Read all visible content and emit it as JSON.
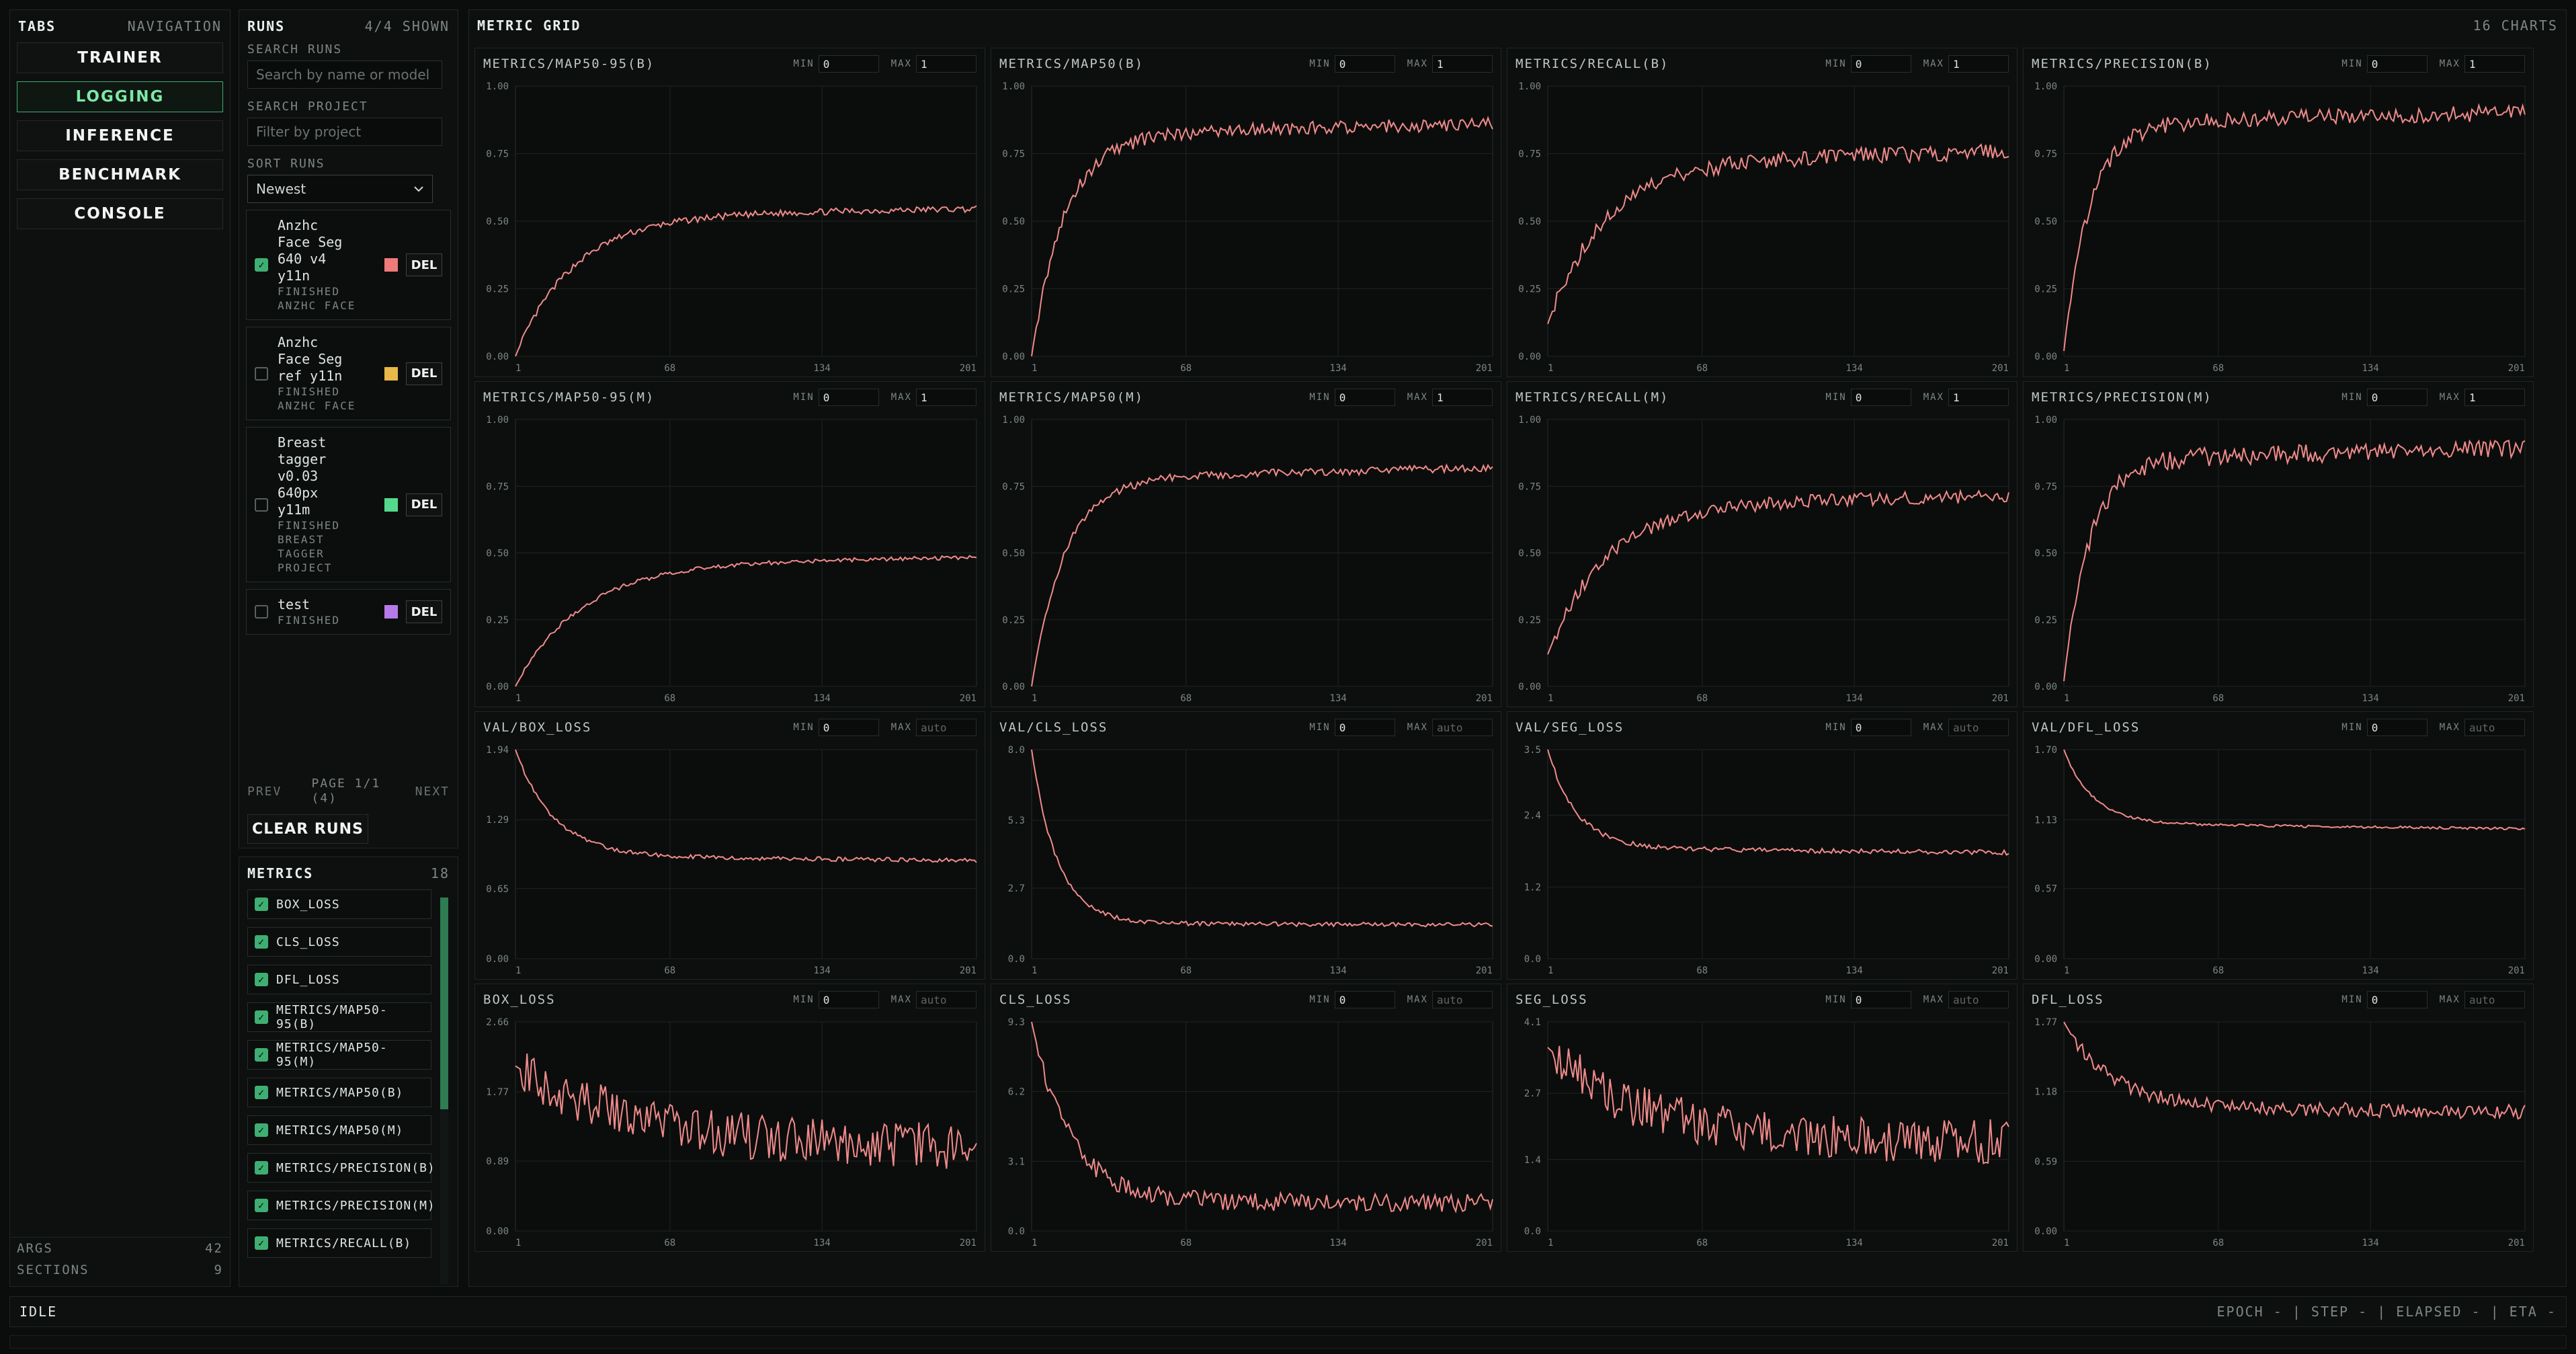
{
  "colors": {
    "series": "#f08b8b",
    "accent": "#3fae72"
  },
  "tabs": {
    "title": "TABS",
    "meta": "NAVIGATION",
    "items": [
      {
        "label": "TRAINER",
        "active": false
      },
      {
        "label": "LOGGING",
        "active": true
      },
      {
        "label": "INFERENCE",
        "active": false
      },
      {
        "label": "BENCHMARK",
        "active": false
      },
      {
        "label": "CONSOLE",
        "active": false
      }
    ],
    "footer": [
      {
        "label": "ARGS",
        "value": "42"
      },
      {
        "label": "SECTIONS",
        "value": "9"
      }
    ]
  },
  "runs": {
    "title": "RUNS",
    "meta": "4/4 SHOWN",
    "search_runs_label": "SEARCH RUNS",
    "search_runs_placeholder": "Search by name or model",
    "search_project_label": "SEARCH PROJECT",
    "search_project_placeholder": "Filter by project",
    "sort_label": "SORT RUNS",
    "sort_value": "Newest",
    "items": [
      {
        "name": "Anzhc Face Seg 640 v4 y11n",
        "status": "FINISHED",
        "project": "ANZHC FACE",
        "checked": true,
        "color": "#ee7a7a",
        "del": "DEL"
      },
      {
        "name": "Anzhc Face Seg ref y11n",
        "status": "FINISHED",
        "project": "ANZHC FACE",
        "checked": false,
        "color": "#e8b84a",
        "del": "DEL"
      },
      {
        "name": "Breast tagger v0.03 640px y11m",
        "status": "FINISHED",
        "project": "BREAST TAGGER PROJECT",
        "checked": false,
        "color": "#54d98c",
        "del": "DEL"
      },
      {
        "name": "test",
        "status": "FINISHED",
        "project": "",
        "checked": false,
        "color": "#b879e8",
        "del": "DEL"
      }
    ],
    "pager": {
      "prev": "PREV",
      "page": "PAGE 1/1 (4)",
      "next": "NEXT"
    },
    "clear_label": "CLEAR RUNS"
  },
  "metrics": {
    "title": "METRICS",
    "count": "18",
    "items": [
      "BOX_LOSS",
      "CLS_LOSS",
      "DFL_LOSS",
      "METRICS/MAP50-95(B)",
      "METRICS/MAP50-95(M)",
      "METRICS/MAP50(B)",
      "METRICS/MAP50(M)",
      "METRICS/PRECISION(B)",
      "METRICS/PRECISION(M)",
      "METRICS/RECALL(B)"
    ]
  },
  "grid": {
    "title": "METRIC GRID",
    "count": "16 CHARTS",
    "min_label": "MIN",
    "max_label": "MAX",
    "auto_placeholder": "auto"
  },
  "chart_data": [
    {
      "type": "line",
      "title": "METRICS/MAP50-95(B)",
      "min": "0",
      "max": "1",
      "ylim": [
        0,
        1
      ],
      "yticks": [
        "0.00",
        "0.25",
        "0.50",
        "0.75",
        "1.00"
      ],
      "xticks": [
        "1",
        "68",
        "134",
        "201"
      ],
      "x_range": [
        1,
        201
      ],
      "curve": {
        "kind": "rise",
        "start": 0.0,
        "end": 0.52,
        "k": 8,
        "noise": 0.012
      }
    },
    {
      "type": "line",
      "title": "METRICS/MAP50(B)",
      "min": "0",
      "max": "1",
      "ylim": [
        0,
        1
      ],
      "yticks": [
        "0.00",
        "0.25",
        "0.50",
        "0.75",
        "1.00"
      ],
      "xticks": [
        "1",
        "68",
        "134",
        "201"
      ],
      "x_range": [
        1,
        201
      ],
      "curve": {
        "kind": "rise",
        "start": 0.0,
        "end": 0.82,
        "k": 14,
        "noise": 0.025
      }
    },
    {
      "type": "line",
      "title": "METRICS/RECALL(B)",
      "min": "0",
      "max": "1",
      "ylim": [
        0,
        1
      ],
      "yticks": [
        "0.00",
        "0.25",
        "0.50",
        "0.75",
        "1.00"
      ],
      "xticks": [
        "1",
        "68",
        "134",
        "201"
      ],
      "x_range": [
        1,
        201
      ],
      "curve": {
        "kind": "rise",
        "start": 0.12,
        "end": 0.72,
        "k": 8,
        "noise": 0.03
      }
    },
    {
      "type": "line",
      "title": "METRICS/PRECISION(B)",
      "min": "0",
      "max": "1",
      "ylim": [
        0,
        1
      ],
      "yticks": [
        "0.00",
        "0.25",
        "0.50",
        "0.75",
        "1.00"
      ],
      "xticks": [
        "1",
        "68",
        "134",
        "201"
      ],
      "x_range": [
        1,
        201
      ],
      "curve": {
        "kind": "rise",
        "start": 0.02,
        "end": 0.86,
        "k": 18,
        "noise": 0.03
      }
    },
    {
      "type": "line",
      "title": "METRICS/MAP50-95(M)",
      "min": "0",
      "max": "1",
      "ylim": [
        0,
        1
      ],
      "yticks": [
        "0.00",
        "0.25",
        "0.50",
        "0.75",
        "1.00"
      ],
      "xticks": [
        "1",
        "68",
        "134",
        "201"
      ],
      "x_range": [
        1,
        201
      ],
      "curve": {
        "kind": "rise",
        "start": 0.0,
        "end": 0.46,
        "k": 7,
        "noise": 0.008
      }
    },
    {
      "type": "line",
      "title": "METRICS/MAP50(M)",
      "min": "0",
      "max": "1",
      "ylim": [
        0,
        1
      ],
      "yticks": [
        "0.00",
        "0.25",
        "0.50",
        "0.75",
        "1.00"
      ],
      "xticks": [
        "1",
        "68",
        "134",
        "201"
      ],
      "x_range": [
        1,
        201
      ],
      "curve": {
        "kind": "rise",
        "start": 0.0,
        "end": 0.78,
        "k": 14,
        "noise": 0.015
      }
    },
    {
      "type": "line",
      "title": "METRICS/RECALL(M)",
      "min": "0",
      "max": "1",
      "ylim": [
        0,
        1
      ],
      "yticks": [
        "0.00",
        "0.25",
        "0.50",
        "0.75",
        "1.00"
      ],
      "xticks": [
        "1",
        "68",
        "134",
        "201"
      ],
      "x_range": [
        1,
        201
      ],
      "curve": {
        "kind": "rise",
        "start": 0.12,
        "end": 0.68,
        "k": 8,
        "noise": 0.025
      }
    },
    {
      "type": "line",
      "title": "METRICS/PRECISION(M)",
      "min": "0",
      "max": "1",
      "ylim": [
        0,
        1
      ],
      "yticks": [
        "0.00",
        "0.25",
        "0.50",
        "0.75",
        "1.00"
      ],
      "xticks": [
        "1",
        "68",
        "134",
        "201"
      ],
      "x_range": [
        1,
        201
      ],
      "curve": {
        "kind": "rise",
        "start": 0.02,
        "end": 0.85,
        "k": 18,
        "noise": 0.035
      }
    },
    {
      "type": "line",
      "title": "VAL/BOX_LOSS",
      "min": "0",
      "max": "",
      "ylim": [
        0,
        1.94
      ],
      "yticks": [
        "0.00",
        "0.65",
        "1.29",
        "1.94"
      ],
      "xticks": [
        "1",
        "68",
        "134",
        "201"
      ],
      "x_range": [
        1,
        201
      ],
      "curve": {
        "kind": "decay",
        "start": 1.94,
        "end": 0.95,
        "k": 12,
        "noise": 0.02
      }
    },
    {
      "type": "line",
      "title": "VAL/CLS_LOSS",
      "min": "0",
      "max": "",
      "ylim": [
        0,
        8.0
      ],
      "yticks": [
        "0.0",
        "2.7",
        "5.3",
        "8.0"
      ],
      "xticks": [
        "1",
        "68",
        "134",
        "201"
      ],
      "x_range": [
        1,
        201
      ],
      "curve": {
        "kind": "decay",
        "start": 8.0,
        "end": 1.35,
        "k": 18,
        "noise": 0.08
      }
    },
    {
      "type": "line",
      "title": "VAL/SEG_LOSS",
      "min": "0",
      "max": "",
      "ylim": [
        0,
        3.5
      ],
      "yticks": [
        "0.0",
        "1.2",
        "2.4",
        "3.5"
      ],
      "xticks": [
        "1",
        "68",
        "134",
        "201"
      ],
      "x_range": [
        1,
        201
      ],
      "curve": {
        "kind": "decay",
        "start": 3.5,
        "end": 1.85,
        "k": 16,
        "noise": 0.04
      }
    },
    {
      "type": "line",
      "title": "VAL/DFL_LOSS",
      "min": "0",
      "max": "",
      "ylim": [
        0,
        1.7
      ],
      "yticks": [
        "0.00",
        "0.57",
        "1.13",
        "1.70"
      ],
      "xticks": [
        "1",
        "68",
        "134",
        "201"
      ],
      "x_range": [
        1,
        201
      ],
      "curve": {
        "kind": "decay",
        "start": 1.7,
        "end": 1.1,
        "k": 16,
        "noise": 0.01
      }
    },
    {
      "type": "line",
      "title": "BOX_LOSS",
      "min": "0",
      "max": "",
      "ylim": [
        0,
        2.66
      ],
      "yticks": [
        "0.00",
        "0.89",
        "1.77",
        "2.66"
      ],
      "xticks": [
        "1",
        "68",
        "134",
        "201"
      ],
      "x_range": [
        1,
        201
      ],
      "curve": {
        "kind": "decay",
        "start": 2.1,
        "end": 1.1,
        "k": 4,
        "noise": 0.3
      }
    },
    {
      "type": "line",
      "title": "CLS_LOSS",
      "min": "0",
      "max": "",
      "ylim": [
        0,
        9.3
      ],
      "yticks": [
        "0.0",
        "3.1",
        "6.2",
        "9.3"
      ],
      "xticks": [
        "1",
        "68",
        "134",
        "201"
      ],
      "x_range": [
        1,
        201
      ],
      "curve": {
        "kind": "decay",
        "start": 9.3,
        "end": 1.3,
        "k": 12,
        "noise": 0.4
      }
    },
    {
      "type": "line",
      "title": "SEG_LOSS",
      "min": "0",
      "max": "",
      "ylim": [
        0,
        4.1
      ],
      "yticks": [
        "0.0",
        "1.4",
        "2.7",
        "4.1"
      ],
      "xticks": [
        "1",
        "68",
        "134",
        "201"
      ],
      "x_range": [
        1,
        201
      ],
      "curve": {
        "kind": "decay",
        "start": 3.6,
        "end": 1.8,
        "k": 5,
        "noise": 0.45
      }
    },
    {
      "type": "line",
      "title": "DFL_LOSS",
      "min": "0",
      "max": "",
      "ylim": [
        0,
        1.77
      ],
      "yticks": [
        "0.00",
        "0.59",
        "1.18",
        "1.77"
      ],
      "xticks": [
        "1",
        "68",
        "134",
        "201"
      ],
      "x_range": [
        1,
        201
      ],
      "curve": {
        "kind": "decay",
        "start": 1.77,
        "end": 1.05,
        "k": 10,
        "noise": 0.06
      }
    }
  ],
  "status": {
    "left": "IDLE",
    "right": "EPOCH - | STEP - | ELAPSED - | ETA -"
  }
}
